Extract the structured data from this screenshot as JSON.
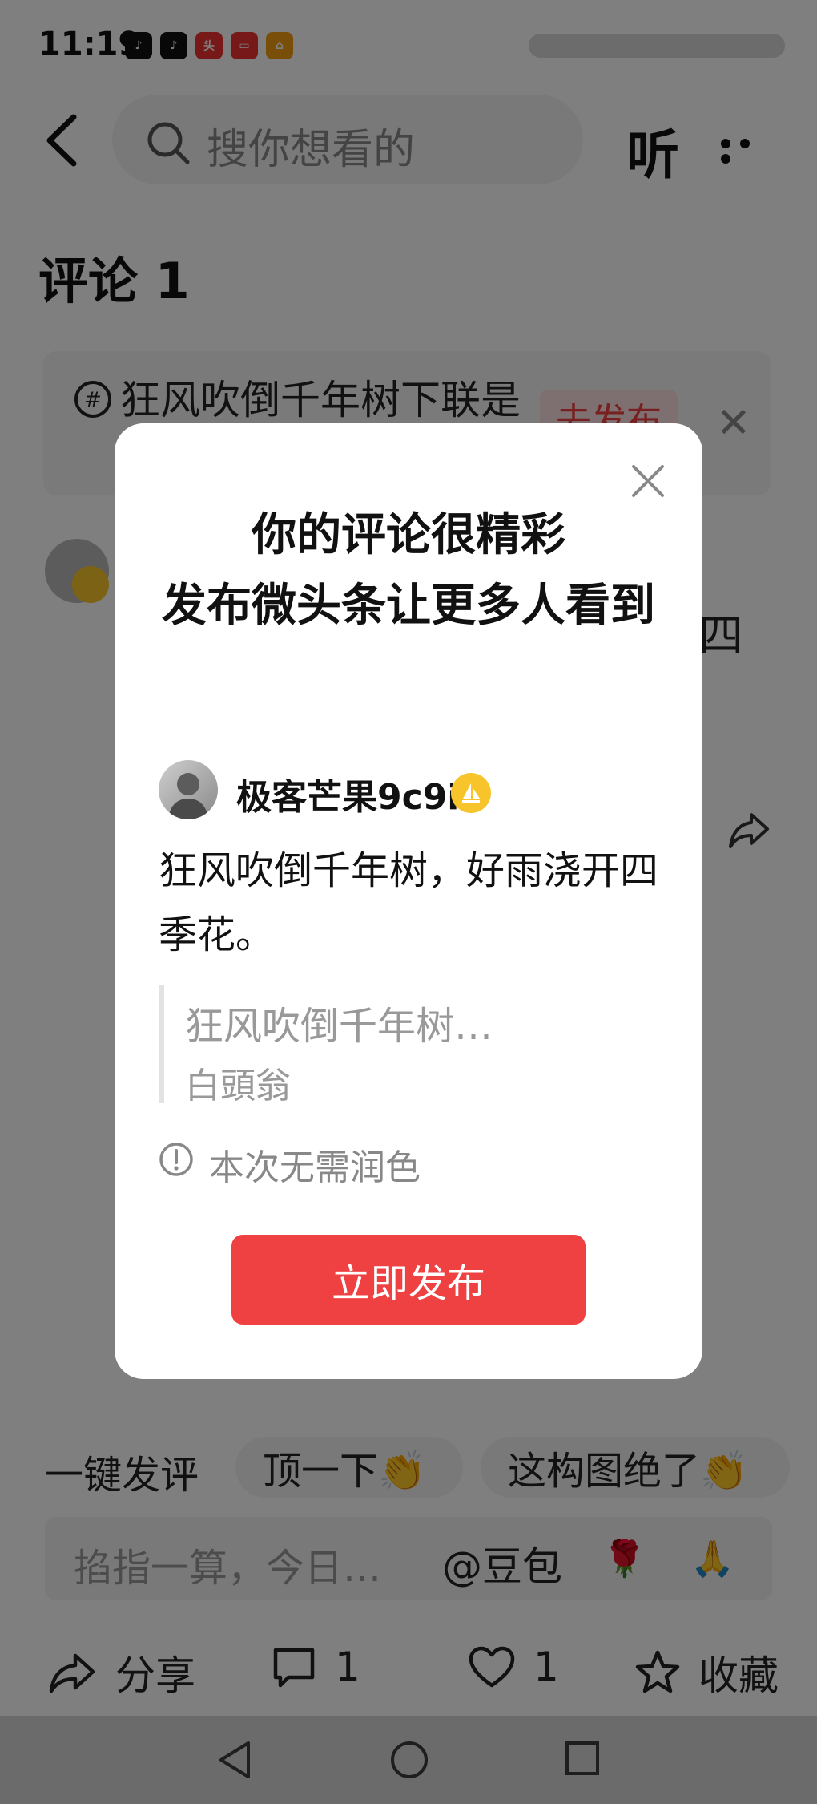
{
  "status_bar": {
    "time": "11:19"
  },
  "header": {
    "search_placeholder": "搜你想看的",
    "listen_label": "听"
  },
  "comments": {
    "title": "评论 1"
  },
  "suggestion_card": {
    "text": "狂风吹倒千年树下联是",
    "badge": "去发布"
  },
  "background_comment": {
    "trailing_char": "四"
  },
  "quick_reply": {
    "label": "一键发评",
    "chips": [
      "顶一下👏",
      "这构图绝了👏"
    ]
  },
  "input_bar": {
    "placeholder": "掐指一算，今日…",
    "mention": "@豆包",
    "emoji_1": "🌹",
    "emoji_2": "🙏"
  },
  "actions": {
    "share": "分享",
    "comment_count": "1",
    "like_count": "1",
    "favorite": "收藏"
  },
  "modal": {
    "title_line1": "你的评论很精彩",
    "title_line2": "发布微头条让更多人看到",
    "user_name": "极客芒果9c9i",
    "body": "狂风吹倒千年树，好雨浇开四季花。",
    "quote_title": "狂风吹倒千年树…",
    "quote_author": "白頭翁",
    "notice": "本次无需润色",
    "publish_button": "立即发布"
  },
  "colors": {
    "accent": "#f04142",
    "badge_gold": "#f7c52b"
  }
}
